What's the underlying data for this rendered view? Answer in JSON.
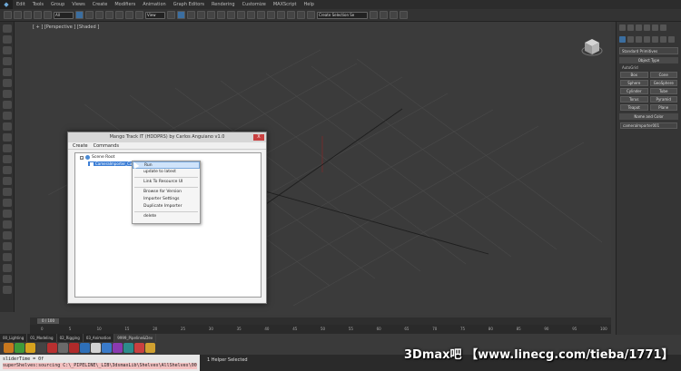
{
  "menubar": {
    "items": [
      "Edit",
      "Tools",
      "Group",
      "Views",
      "Create",
      "Modifiers",
      "Animation",
      "Graph Editors",
      "Rendering",
      "Customize",
      "MAXScript",
      "Help"
    ],
    "title": "Autodesk 3ds Max 2014 x64  Untitled"
  },
  "toolbar": {
    "selection_filter": "All",
    "ref_coord": "View",
    "named_selection": "Create Selection Se"
  },
  "viewport": {
    "label": "[ + ] [Perspective ] [Shaded ]"
  },
  "command_panel": {
    "category": "Standard Primitives",
    "object_type_title": "Object Type",
    "autogrid": "AutoGrid",
    "buttons": [
      "Box",
      "Cone",
      "Sphere",
      "GeoSphere",
      "Cylinder",
      "Tube",
      "Torus",
      "Pyramid",
      "Teapot",
      "Plane"
    ],
    "name_color_title": "Name and Color",
    "name_value": "cameraImporter001"
  },
  "dialog": {
    "title": "Mango Track IT (HDDPRS) by Carlos Anguiano v1.0",
    "close": "X",
    "menu": [
      "Create",
      "Commands"
    ],
    "tree_root": "Scene Root",
    "tree_child": "CameraImporter_Cam_v1"
  },
  "context_menu": {
    "items": [
      "Run",
      "update to latest",
      "Link To Resource UI",
      "Browse for Version",
      "Importer Settings",
      "Duplicate Importer",
      "delete"
    ]
  },
  "timeline": {
    "slider": "0 / 100",
    "ticks": [
      "0",
      "5",
      "10",
      "15",
      "20",
      "25",
      "30",
      "35",
      "40",
      "45",
      "50",
      "55",
      "60",
      "65",
      "70",
      "75",
      "80",
      "85",
      "90",
      "95",
      "100"
    ]
  },
  "bottom_tabs": [
    "00_Lighting",
    "01_Modeling",
    "02_Rigging",
    "03_Animation",
    "9999_Pipeline&Dev"
  ],
  "maxscript": {
    "line1": "sliderTime = 0f",
    "line2": "superShelves:sourcing C:\\_PIPELINE\\_LIB\\3dsmaxLib\\Shelves\\AllShelves\\00 Track"
  },
  "status": {
    "text": "1 Helper Selected"
  },
  "watermark": "3Dmax吧 【www.linecg.com/tieba/1771】",
  "colors": {
    "viewport_bg": "#3b3b3b",
    "selection_blue": "#3d7fd6",
    "dialog_bg": "#f0f0f0"
  }
}
